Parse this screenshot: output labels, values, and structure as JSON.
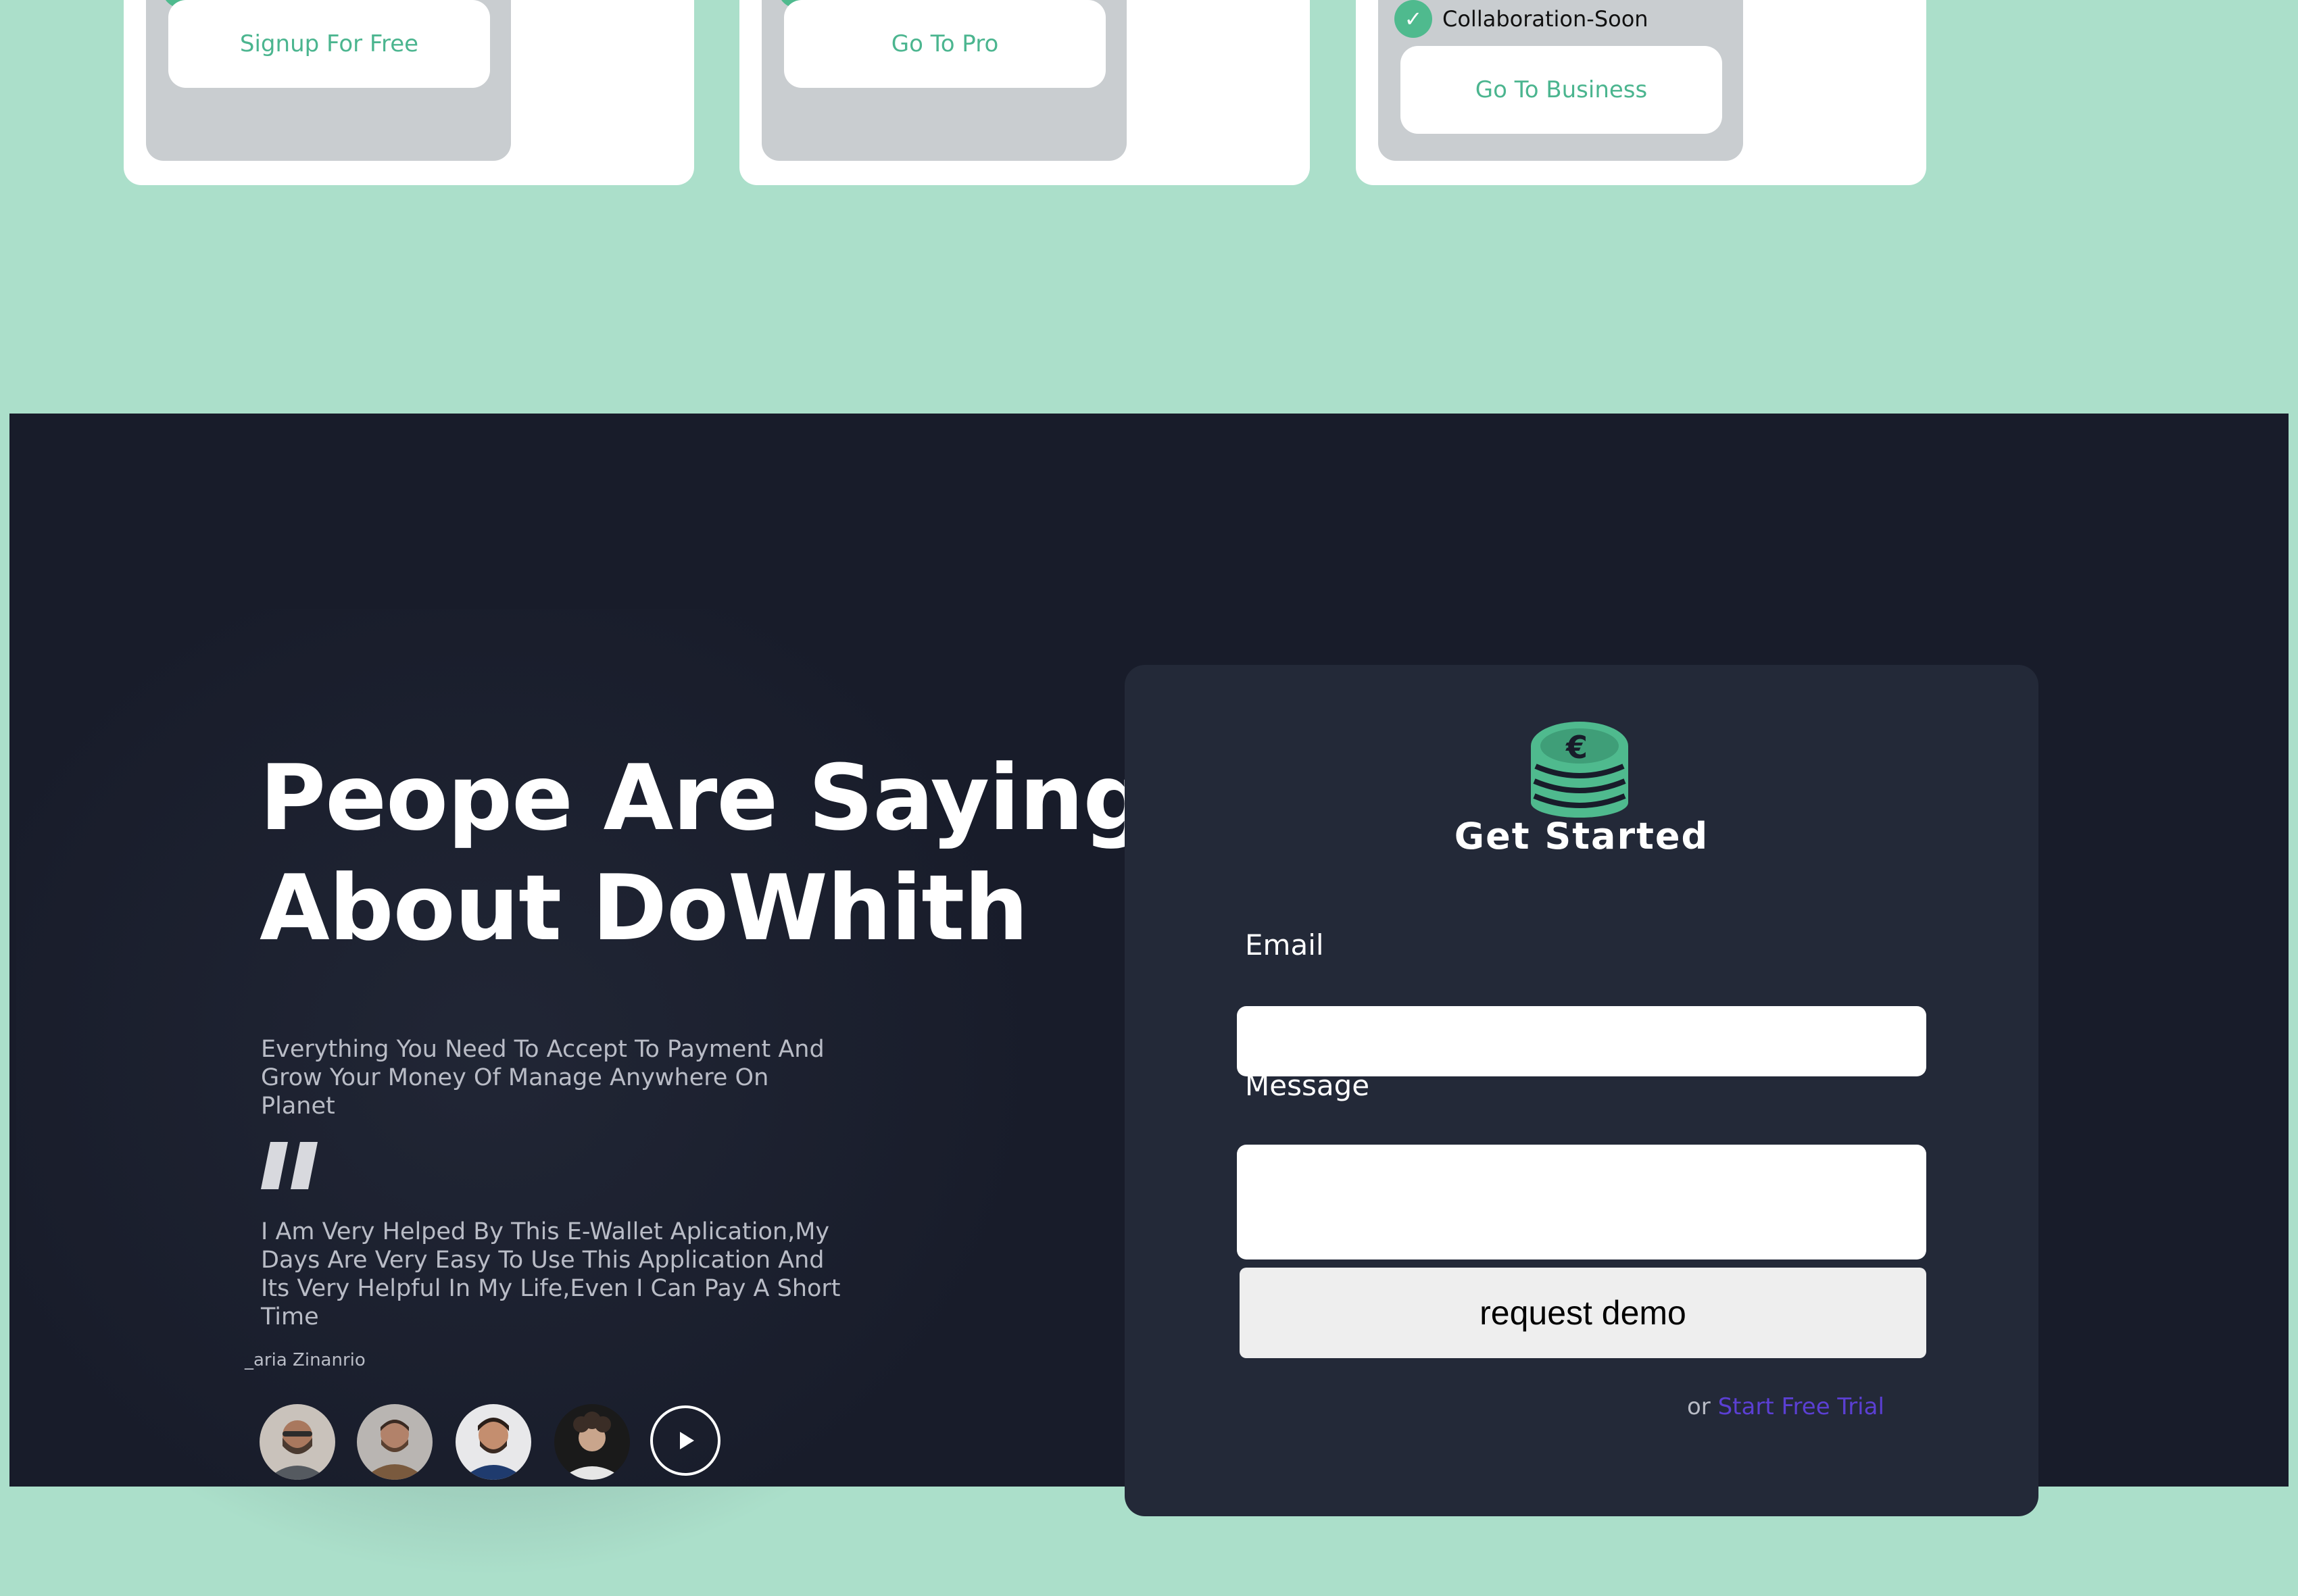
{
  "pricing": {
    "plans": [
      {
        "cta_label": "Signup For Free"
      },
      {
        "cta_label": "Go To Pro"
      },
      {
        "cta_label": "Go To Business",
        "feature": "Collaboration-Soon"
      }
    ],
    "check_glyph": "✓"
  },
  "testimonials": {
    "heading": "Peope Are Saying\nAbout DoWhith",
    "intro": "Everything You Need To Accept To Payment And Grow Your Money Of Manage Anywhere On Planet",
    "quote": "I Am Very Helped By This E-Wallet Aplication,My Days Are Very Easy To Use This Application And Its Very Helpful In My Life,Even I Can Pay A Short Time",
    "author": "_aria Zinanrio",
    "quote_icon": "quote-icon",
    "play_icon": "play-icon"
  },
  "form": {
    "logo_icon": "coin-stack-euro-icon",
    "title": "Get Started",
    "email_label": "Email",
    "email_value": "",
    "message_label": "Message",
    "message_value": "",
    "submit_label": "request demo",
    "alt_prefix": "or",
    "alt_link": "Start Free Trial"
  },
  "colors": {
    "page_bg": "#abdfca",
    "dark_bg": "#181c2a",
    "form_bg": "#232938",
    "accent_green": "#4bb58f",
    "link_purple": "#5b3fd3"
  }
}
